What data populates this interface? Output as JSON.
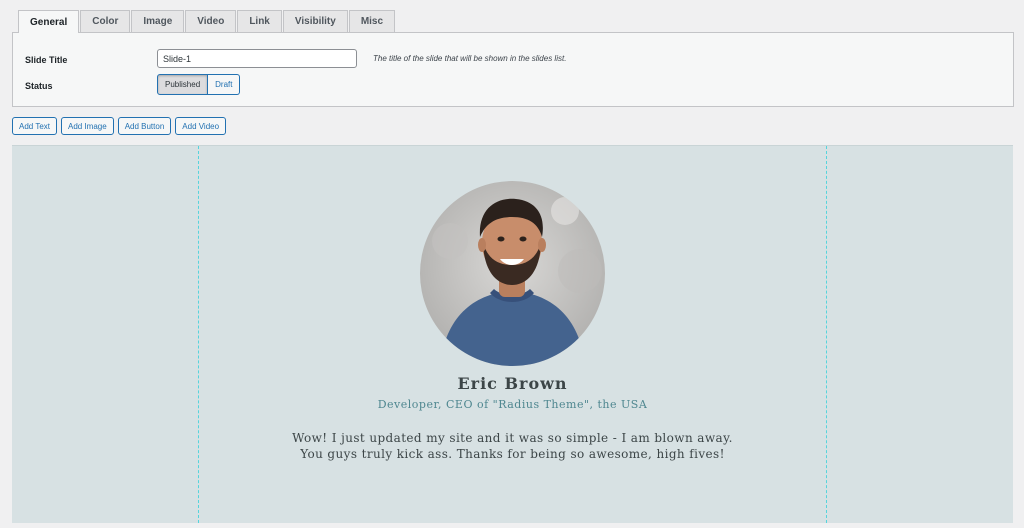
{
  "tabs": [
    {
      "label": "General",
      "active": true
    },
    {
      "label": "Color"
    },
    {
      "label": "Image"
    },
    {
      "label": "Video"
    },
    {
      "label": "Link"
    },
    {
      "label": "Visibility"
    },
    {
      "label": "Misc"
    }
  ],
  "general": {
    "slide_title_label": "Slide Title",
    "slide_title_value": "Slide-1",
    "slide_title_hint": "The title of the slide that will be shown in the slides list.",
    "status_label": "Status",
    "status_options": [
      "Published",
      "Draft"
    ],
    "status_selected": "Published"
  },
  "add_buttons": [
    "Add Text",
    "Add Image",
    "Add Button",
    "Add Video"
  ],
  "slide": {
    "background_color": "#d7e1e3",
    "guide_color": "#56d4dc",
    "name": "Eric Brown",
    "role": "Developer, CEO of \"Radius Theme\", the USA",
    "quote_line1": "Wow! I just updated my site and it was so simple - I am blown away.",
    "quote_line2": "You guys truly kick ass. Thanks for being so awesome, high fives!",
    "name_color": "#3c4547",
    "role_color": "#4f8790"
  }
}
